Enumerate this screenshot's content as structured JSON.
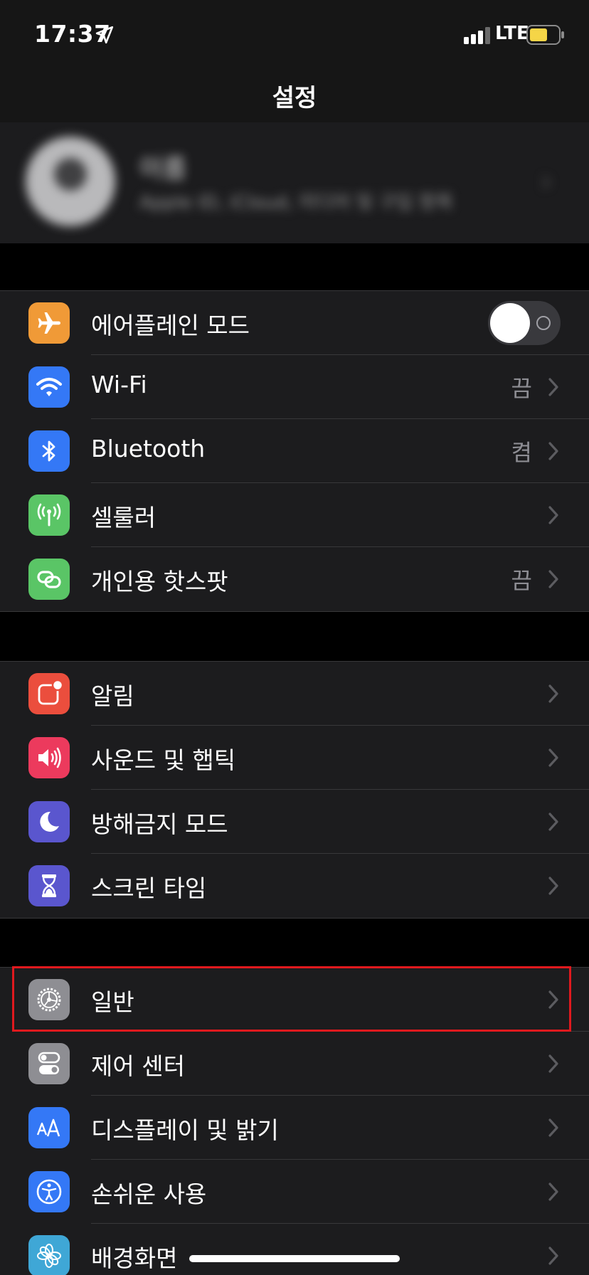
{
  "status": {
    "time": "17:37",
    "network": "LTE",
    "battery_color": "#f5d547"
  },
  "nav": {
    "title": "설정"
  },
  "profile": {
    "name": "이름",
    "subtitle": "Apple ID, iCloud, 미디어 및 구입 항목"
  },
  "colors": {
    "orange": "#f09a37",
    "blue": "#3478f6",
    "green": "#5ac566",
    "red": "#eb4e3d",
    "pink": "#ec3a5d",
    "indigo": "#5a56ce",
    "gray": "#8e8e93",
    "highlight": "#e0191e"
  },
  "group1": [
    {
      "label": "에어플레인 모드",
      "icon": "airplane-icon",
      "toggle": false
    },
    {
      "label": "Wi-Fi",
      "icon": "wifi-icon",
      "value": "끔"
    },
    {
      "label": "Bluetooth",
      "icon": "bluetooth-icon",
      "value": "켬"
    },
    {
      "label": "셀룰러",
      "icon": "cellular-antenna-icon",
      "value": ""
    },
    {
      "label": "개인용 핫스팟",
      "icon": "hotspot-link-icon",
      "value": "끔"
    }
  ],
  "group2": [
    {
      "label": "알림",
      "icon": "notifications-icon"
    },
    {
      "label": "사운드 및 햅틱",
      "icon": "speaker-icon"
    },
    {
      "label": "방해금지 모드",
      "icon": "moon-icon"
    },
    {
      "label": "스크린 타임",
      "icon": "hourglass-icon"
    }
  ],
  "group3": [
    {
      "label": "일반",
      "icon": "gear-icon",
      "highlighted": true
    },
    {
      "label": "제어 센터",
      "icon": "switches-icon"
    },
    {
      "label": "디스플레이 및 밝기",
      "icon": "text-size-icon"
    },
    {
      "label": "손쉬운 사용",
      "icon": "accessibility-icon"
    },
    {
      "label": "배경화면",
      "icon": "flower-icon"
    }
  ]
}
